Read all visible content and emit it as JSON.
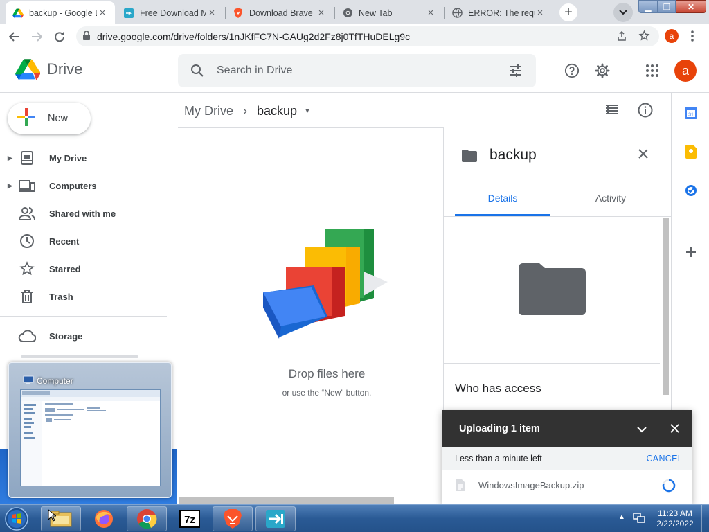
{
  "browser": {
    "tabs": [
      {
        "title": "backup - Google Drive",
        "favicon": "google-drive-icon",
        "active": true
      },
      {
        "title": "Free Download Manager",
        "favicon": "fdm-icon",
        "active": false
      },
      {
        "title": "Download Brave Browser",
        "favicon": "brave-icon",
        "active": false
      },
      {
        "title": "New Tab",
        "favicon": "chrome-icon",
        "active": false
      },
      {
        "title": "ERROR: The requested URL",
        "favicon": "globe-icon",
        "active": false
      }
    ],
    "url": "drive.google.com/drive/folders/1nJKfFC7N-GAUg2d2Fz8j0TfTHuDELg9c",
    "profile_initial": "a"
  },
  "drive": {
    "product": "Drive",
    "search_placeholder": "Search in Drive",
    "avatar_initial": "a",
    "new_label": "New",
    "nav": [
      {
        "label": "My Drive",
        "icon": "my-drive-icon",
        "expandable": true
      },
      {
        "label": "Computers",
        "icon": "computers-icon",
        "expandable": true
      },
      {
        "label": "Shared with me",
        "icon": "shared-icon",
        "expandable": false
      },
      {
        "label": "Recent",
        "icon": "clock-icon",
        "expandable": false
      },
      {
        "label": "Starred",
        "icon": "star-icon",
        "expandable": false
      },
      {
        "label": "Trash",
        "icon": "trash-icon",
        "expandable": false
      }
    ],
    "storage_label": "Storage",
    "breadcrumb": {
      "root": "My Drive",
      "current": "backup"
    },
    "empty": {
      "title": "Drop files here",
      "subtitle": "or use the “New” button."
    },
    "details": {
      "folder_name": "backup",
      "tabs": [
        "Details",
        "Activity"
      ],
      "active_tab": "Details",
      "access_heading": "Who has access"
    },
    "upload": {
      "title": "Uploading 1 item",
      "status": "Less than a minute left",
      "cancel": "CANCEL",
      "file": "WindowsImageBackup.zip"
    },
    "colors": {
      "accent": "#1a73e8",
      "toast_dark": "#323232",
      "avatar": "#e8430a"
    }
  },
  "os": {
    "peek_title": "Computer",
    "clock_time": "11:23 AM",
    "clock_date": "2/22/2022",
    "taskbar_items": [
      "file-explorer-icon",
      "firefox-icon",
      "chrome-icon",
      "7zip-icon",
      "brave-icon",
      "fdm-icon"
    ]
  }
}
